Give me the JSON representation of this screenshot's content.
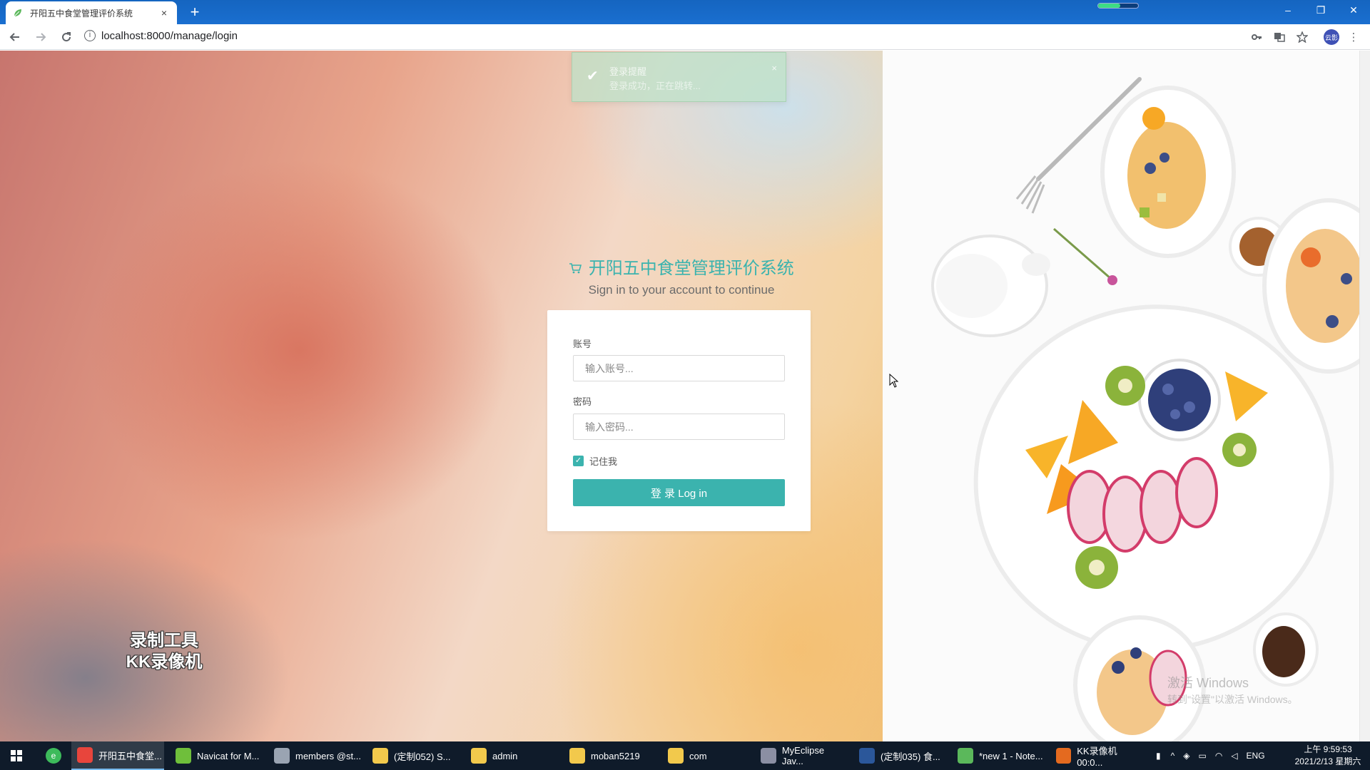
{
  "browser": {
    "tab_title": "开阳五中食堂管理评价系统",
    "tab_close": "×",
    "new_tab": "+",
    "url": "localhost:8000/manage/login",
    "window_minimize": "–",
    "window_restore": "❐",
    "window_close": "✕",
    "profile_label": "云影"
  },
  "toast": {
    "title": "登录提醒",
    "message": "登录成功，正在跳转...",
    "close": "×"
  },
  "login": {
    "brand_title": "开阳五中食堂管理评价系统",
    "subtitle": "Sign in to your account to continue",
    "account_label": "账号",
    "account_placeholder": "输入账号...",
    "password_label": "密码",
    "password_placeholder": "输入密码...",
    "remember_label": "记住我",
    "remember_checked": true,
    "submit_label": "登 录 Log in",
    "accent_color": "#3bb3ae"
  },
  "overlays": {
    "recorder_watermark_line1": "录制工具",
    "recorder_watermark_line2": "KK录像机",
    "activate_windows_title": "激活 Windows",
    "activate_windows_sub": "转到\"设置\"以激活 Windows。"
  },
  "taskbar": {
    "items": [
      {
        "label": "开阳五中食堂...",
        "icon": "chrome-icon",
        "active": true
      },
      {
        "label": "Navicat for M...",
        "icon": "navicat-icon",
        "active": false
      },
      {
        "label": "members @st...",
        "icon": "table-icon",
        "active": false
      },
      {
        "label": "(定制052) S...",
        "icon": "folder-icon",
        "active": false
      },
      {
        "label": "admin",
        "icon": "folder-icon",
        "active": false
      },
      {
        "label": "moban5219",
        "icon": "folder-icon",
        "active": false
      },
      {
        "label": "com",
        "icon": "folder-icon",
        "active": false
      },
      {
        "label": "MyEclipse Jav...",
        "icon": "myeclipse-icon",
        "active": false
      },
      {
        "label": "(定制035) 食...",
        "icon": "word-icon",
        "active": false
      },
      {
        "label": "*new 1 - Note...",
        "icon": "notepad-icon",
        "active": false
      },
      {
        "label": "KK录像机 00:0...",
        "icon": "kk-recorder-icon",
        "active": false
      }
    ],
    "language": "ENG",
    "time": "上午 9:59:53",
    "date": "2021/2/13 星期六"
  }
}
